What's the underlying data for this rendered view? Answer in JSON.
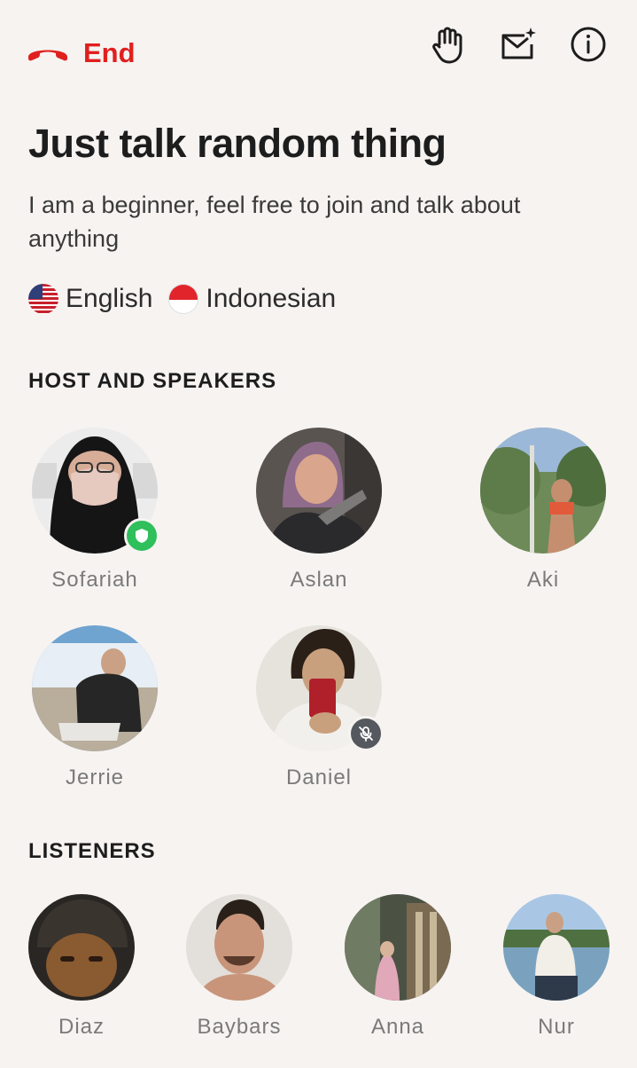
{
  "header": {
    "end_label": "End",
    "icons": [
      "phone-hangup-icon",
      "raise-hand-icon",
      "mail-sparkle-icon",
      "info-icon"
    ]
  },
  "room": {
    "title": "Just talk random thing",
    "description": "I am a beginner, feel free to join and talk about anything",
    "languages": [
      {
        "label": "English",
        "flag": "us-flag-icon"
      },
      {
        "label": "Indonesian",
        "flag": "indonesia-flag-icon"
      }
    ]
  },
  "sections": {
    "speakers_title": "HOST AND SPEAKERS",
    "listeners_title": "LISTENERS"
  },
  "speakers": [
    {
      "name": "Sofariah",
      "badge": "shield-icon"
    },
    {
      "name": "Aslan"
    },
    {
      "name": "Aki"
    },
    {
      "name": "Jerrie"
    },
    {
      "name": "Daniel",
      "badge": "mic-muted-icon"
    }
  ],
  "listeners": [
    {
      "name": "Diaz"
    },
    {
      "name": "Baybars"
    },
    {
      "name": "Anna"
    },
    {
      "name": "Nur"
    }
  ],
  "colors": {
    "accent_red": "#e0201e",
    "background": "#f6f3f1",
    "host_badge": "#2fbf5b",
    "muted_badge": "#55595f"
  }
}
